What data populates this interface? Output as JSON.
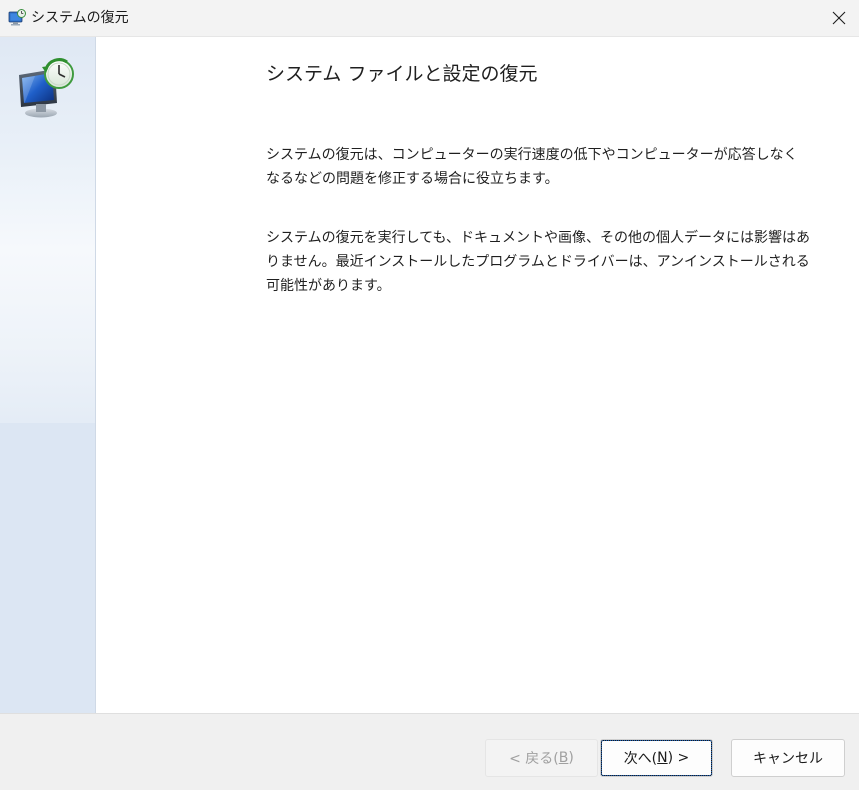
{
  "window": {
    "title": "システムの復元",
    "close_icon": "close-icon",
    "title_icon": "system-restore-icon"
  },
  "sidebar": {
    "icon": "system-restore-monitor-clock-icon"
  },
  "content": {
    "heading": "システム ファイルと設定の復元",
    "paragraph1": "システムの復元は、コンピューターの実行速度の低下やコンピューターが応答しなくなるなどの問題を修正する場合に役立ちます。",
    "paragraph2": "システムの復元を実行しても、ドキュメントや画像、その他の個人データには影響はありません。最近インストールしたプログラムとドライバーは、アンインストールされる可能性があります。"
  },
  "footer": {
    "back_button": {
      "prefix": "< 戻る(",
      "accel": "B",
      "suffix": ")"
    },
    "next_button": {
      "prefix": "次へ(",
      "accel": "N",
      "suffix": ") >"
    },
    "cancel_button": "キャンセル"
  },
  "colors": {
    "sidebar_bg": "#dce6f3",
    "footer_bg": "#f0f0f0",
    "titlebar_bg": "#f3f3f3",
    "disabled_text": "#a0a0a0"
  }
}
